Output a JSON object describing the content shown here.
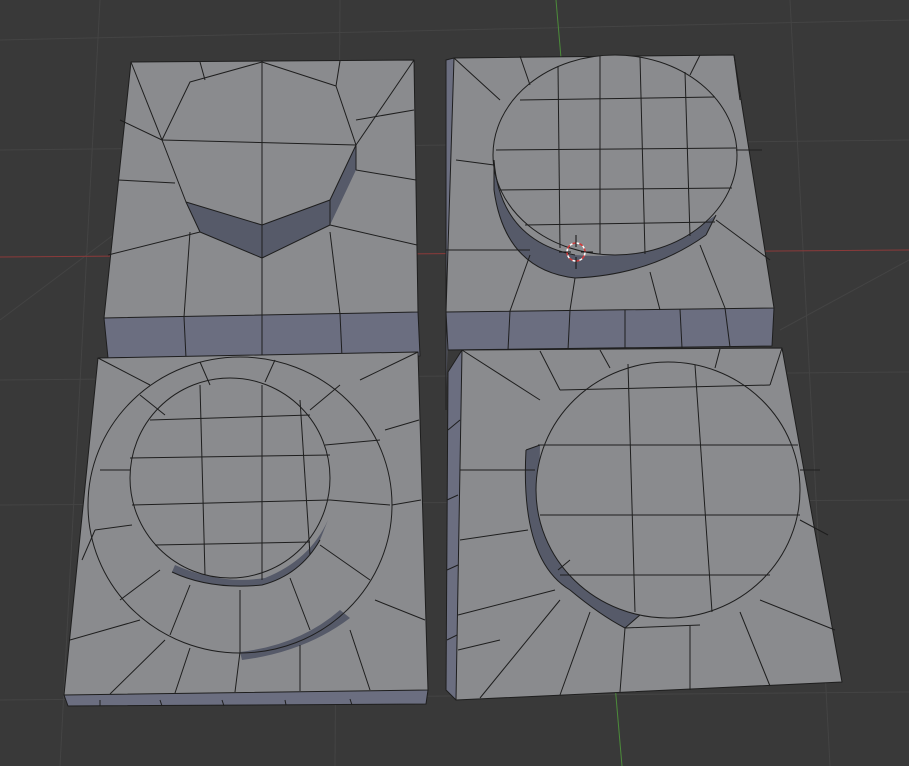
{
  "viewport": {
    "background": "#393939",
    "grid_color": "#444444",
    "x_axis_color": "#8c3a3a",
    "y_axis_color": "#4c8c3a",
    "face_top_color": "#8a8b8e",
    "face_side_color": "#6b6e80",
    "wire_color": "#1e1e1e",
    "cursor_icon": "3d-cursor-icon",
    "meshes": [
      {
        "name": "cube-octagon-extrude"
      },
      {
        "name": "cube-circle-extrude-grid"
      },
      {
        "name": "cube-stepped-circle-extrude"
      },
      {
        "name": "cube-circle-inset"
      }
    ]
  }
}
